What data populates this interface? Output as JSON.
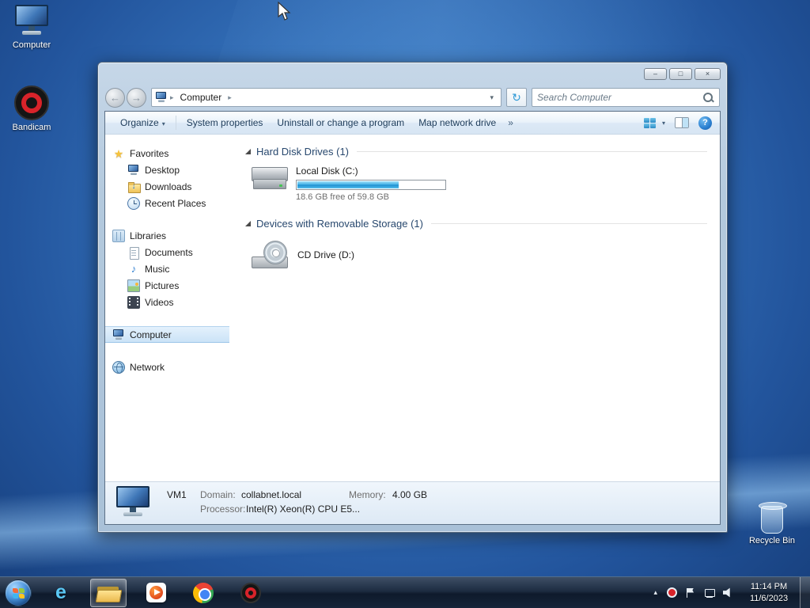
{
  "glyphs": {
    "back": "←",
    "forward": "→",
    "refresh": "↻",
    "chevron": "▸",
    "dropdown": "▾",
    "overflow": "»",
    "star": "★",
    "music": "♪",
    "down_arrow": "↓",
    "help": "?",
    "minimize": "–",
    "maximize": "□",
    "close": "×",
    "tray_chevron": "▴",
    "ie": "e"
  },
  "desktop": {
    "computer_label": "Computer",
    "bandicam_label": "Bandicam",
    "recycle_label": "Recycle Bin"
  },
  "explorer": {
    "breadcrumb": {
      "segment": "Computer"
    },
    "search": {
      "placeholder": "Search Computer"
    },
    "toolbar": {
      "organize": "Organize",
      "system_properties": "System properties",
      "uninstall": "Uninstall or change a program",
      "map_drive": "Map network drive"
    },
    "sidebar": {
      "favorites": "Favorites",
      "favorites_items": [
        "Desktop",
        "Downloads",
        "Recent Places"
      ],
      "libraries": "Libraries",
      "libraries_items": [
        "Documents",
        "Music",
        "Pictures",
        "Videos"
      ],
      "computer": "Computer",
      "network": "Network"
    },
    "main": {
      "section_hdd": "Hard Disk Drives (1)",
      "section_removable": "Devices with Removable Storage (1)",
      "disk": {
        "name": "Local Disk (C:)",
        "free_text": "18.6 GB free of 59.8 GB",
        "used_percent": 69
      },
      "cd": {
        "name": "CD Drive (D:)"
      }
    },
    "details": {
      "name": "VM1",
      "domain_label": "Domain:",
      "domain_value": "collabnet.local",
      "processor_label": "Processor:",
      "processor_value": "Intel(R) Xeon(R) CPU E5...",
      "memory_label": "Memory:",
      "memory_value": "4.00 GB"
    }
  },
  "taskbar": {
    "clock_time": "11:14 PM",
    "clock_date": "11/6/2023"
  }
}
